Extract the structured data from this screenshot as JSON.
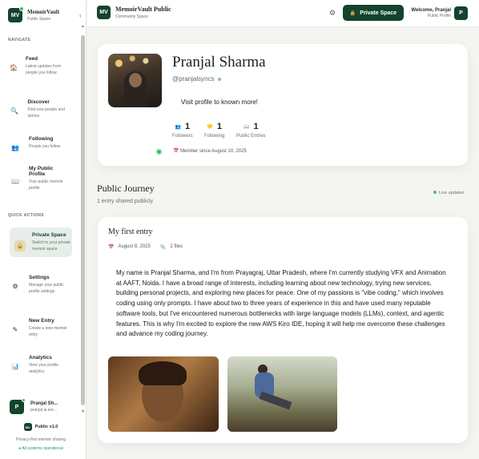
{
  "sidebar": {
    "brand_logo": "MV",
    "brand_title": "MemoirVault",
    "brand_subtitle": "Public Space",
    "collapse_icon": "chevron-left-icon",
    "navigate_label": "NAVIGATE",
    "nav_items": [
      {
        "icon": "house-icon",
        "title": "Feed",
        "desc": "Latest updates from people you follow"
      },
      {
        "icon": "search-icon",
        "title": "Discover",
        "desc": "Find new people and stories"
      },
      {
        "icon": "people-icon",
        "title": "Following",
        "desc": "People you follow"
      },
      {
        "icon": "book-icon",
        "title": "My Public Profile",
        "desc": "Your public memoir profile"
      }
    ],
    "quick_actions_label": "QUICK ACTIONS",
    "quick_actions": [
      {
        "icon": "lock-icon",
        "title": "Private Space",
        "desc": "Switch to your private memoir space"
      },
      {
        "icon": "gear-icon",
        "title": "Settings",
        "desc": "Manage your public profile settings"
      },
      {
        "icon": "pencil-icon",
        "title": "New Entry",
        "desc": "Create a new memoir entry"
      },
      {
        "icon": "chart-icon",
        "title": "Analytics",
        "desc": "View your profile analytics"
      }
    ],
    "user": {
      "avatar": "P",
      "name": "Pranjal Sh...",
      "email": "pranjal.ai.are..."
    },
    "footer": {
      "logo": "MV",
      "version": "Public v1.0",
      "tagline": "Privacy-first memoir sharing",
      "status": "● All systems operational"
    }
  },
  "topbar": {
    "logo": "MV",
    "title": "MemoirVault Public",
    "subtitle": "Community Space",
    "private_button": "Private Space",
    "welcome": "Welcome, Pranjal",
    "welcome_sub": "Public Profile",
    "avatar": "P"
  },
  "profile": {
    "name": "Pranjal Sharma",
    "handle": "@pranjalsyncs",
    "bio": "Visit profile to known more!",
    "stats": [
      {
        "icon": "people-icon",
        "value": "1",
        "label": "Followers"
      },
      {
        "icon": "heart-icon",
        "value": "1",
        "label": "Following"
      },
      {
        "icon": "book-icon",
        "value": "1",
        "label": "Public Entries"
      }
    ],
    "member_since": "Member since August 10, 2025"
  },
  "journey": {
    "title": "Public Journey",
    "subtitle": "1 entry shared publicly",
    "live": "Live updates"
  },
  "entry": {
    "title": "My first entry",
    "date": "August 8, 2025",
    "files": "2 files",
    "body": "My name is Pranjal Sharma, and I'm from Prayagraj, Uttar Pradesh, where I'm currently studying VFX and Animation at AAFT, Noida. I have a broad range of interests, including learning about new technology, trying new services, building personal projects, and exploring new places for peace. One of my passions is \"vibe coding,\" which involves coding using only prompts. I have about two to three years of experience in this and have used many reputable software tools, but I've encountered numerous bottlenecks with large language models (LLMs), context, and agentic features. This is why I'm excited to explore the new AWS Kiro IDE, hoping it will help me overcome these challenges and advance my coding journey."
  }
}
